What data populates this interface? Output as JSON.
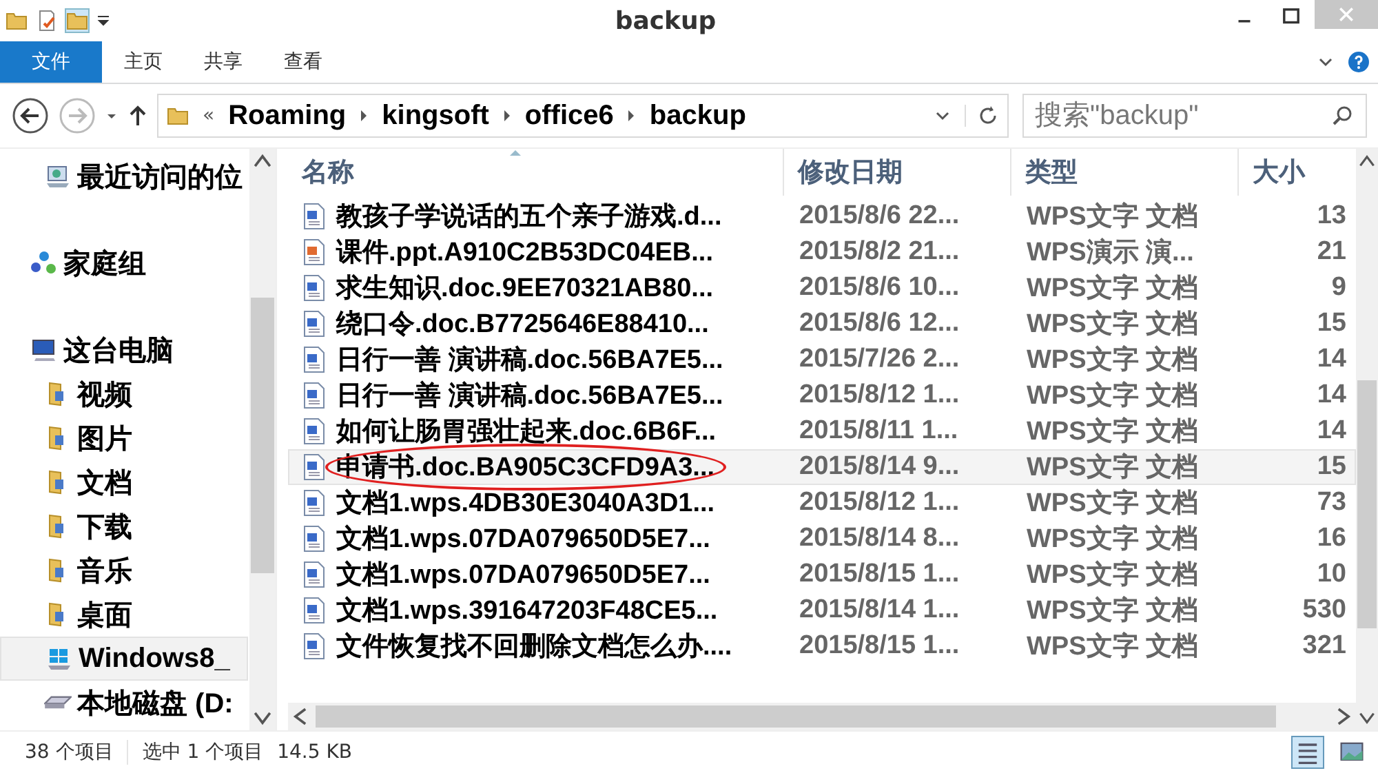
{
  "window": {
    "title": "backup"
  },
  "ribbon_tabs": [
    {
      "label": "文件",
      "selected": true
    },
    {
      "label": "主页",
      "selected": false
    },
    {
      "label": "共享",
      "selected": false
    },
    {
      "label": "查看",
      "selected": false
    }
  ],
  "address": {
    "overflow": "«",
    "path": [
      "Roaming",
      "kingsoft",
      "office6",
      "backup"
    ]
  },
  "search": {
    "placeholder": "搜索\"backup\""
  },
  "sidebar": {
    "items": [
      {
        "label": "最近访问的位",
        "selected": false,
        "kind": "recent"
      },
      {
        "label": "家庭组",
        "selected": false,
        "kind": "homegroup"
      },
      {
        "label": "这台电脑",
        "selected": false,
        "kind": "pc",
        "children": [
          {
            "label": "视频",
            "selected": false,
            "kind": "folder"
          },
          {
            "label": "图片",
            "selected": false,
            "kind": "folder"
          },
          {
            "label": "文档",
            "selected": false,
            "kind": "folder"
          },
          {
            "label": "下载",
            "selected": false,
            "kind": "folder"
          },
          {
            "label": "音乐",
            "selected": false,
            "kind": "folder"
          },
          {
            "label": "桌面",
            "selected": false,
            "kind": "folder"
          },
          {
            "label": "Windows8_",
            "selected": true,
            "kind": "windrive"
          },
          {
            "label": "本地磁盘 (D:",
            "selected": false,
            "kind": "drive"
          }
        ]
      }
    ]
  },
  "table": {
    "columns": [
      "名称",
      "修改日期",
      "类型",
      "大小"
    ],
    "rows": [
      {
        "name": "教孩子学说话的五个亲子游戏.d...",
        "date": "2015/8/6 22...",
        "type": "WPS文字 文档",
        "size": "13",
        "kind": "doc",
        "selected": false
      },
      {
        "name": "课件.ppt.A910C2B53DC04EB...",
        "date": "2015/8/2 21...",
        "type": "WPS演示 演...",
        "size": "21",
        "kind": "ppt",
        "selected": false
      },
      {
        "name": "求生知识.doc.9EE70321AB80...",
        "date": "2015/8/6 10...",
        "type": "WPS文字 文档",
        "size": "9",
        "kind": "doc",
        "selected": false
      },
      {
        "name": "绕口令.doc.B7725646E88410...",
        "date": "2015/8/6 12...",
        "type": "WPS文字 文档",
        "size": "15",
        "kind": "doc",
        "selected": false
      },
      {
        "name": "日行一善 演讲稿.doc.56BA7E5...",
        "date": "2015/7/26 2...",
        "type": "WPS文字 文档",
        "size": "14",
        "kind": "doc",
        "selected": false
      },
      {
        "name": "日行一善 演讲稿.doc.56BA7E5...",
        "date": "2015/8/12 1...",
        "type": "WPS文字 文档",
        "size": "14",
        "kind": "doc",
        "selected": false
      },
      {
        "name": "如何让肠胃强壮起来.doc.6B6F...",
        "date": "2015/8/11 1...",
        "type": "WPS文字 文档",
        "size": "14",
        "kind": "doc",
        "selected": false
      },
      {
        "name": "申请书.doc.BA905C3CFD9A3...",
        "date": "2015/8/14 9...",
        "type": "WPS文字 文档",
        "size": "15",
        "kind": "doc",
        "selected": true
      },
      {
        "name": "文档1.wps.4DB30E3040A3D1...",
        "date": "2015/8/12 1...",
        "type": "WPS文字 文档",
        "size": "73",
        "kind": "doc",
        "selected": false
      },
      {
        "name": "文档1.wps.07DA079650D5E7...",
        "date": "2015/8/14 8...",
        "type": "WPS文字 文档",
        "size": "16",
        "kind": "doc",
        "selected": false
      },
      {
        "name": "文档1.wps.07DA079650D5E7...",
        "date": "2015/8/15 1...",
        "type": "WPS文字 文档",
        "size": "10",
        "kind": "doc",
        "selected": false
      },
      {
        "name": "文档1.wps.391647203F48CE5...",
        "date": "2015/8/14 1...",
        "type": "WPS文字 文档",
        "size": "530",
        "kind": "doc",
        "selected": false
      },
      {
        "name": "文件恢复找不回删除文档怎么办....",
        "date": "2015/8/15 1...",
        "type": "WPS文字 文档",
        "size": "321",
        "kind": "doc",
        "selected": false
      }
    ]
  },
  "status_bar": {
    "count": "38 个项目",
    "selection": "选中 1 个项目",
    "size": "14.5 KB"
  }
}
